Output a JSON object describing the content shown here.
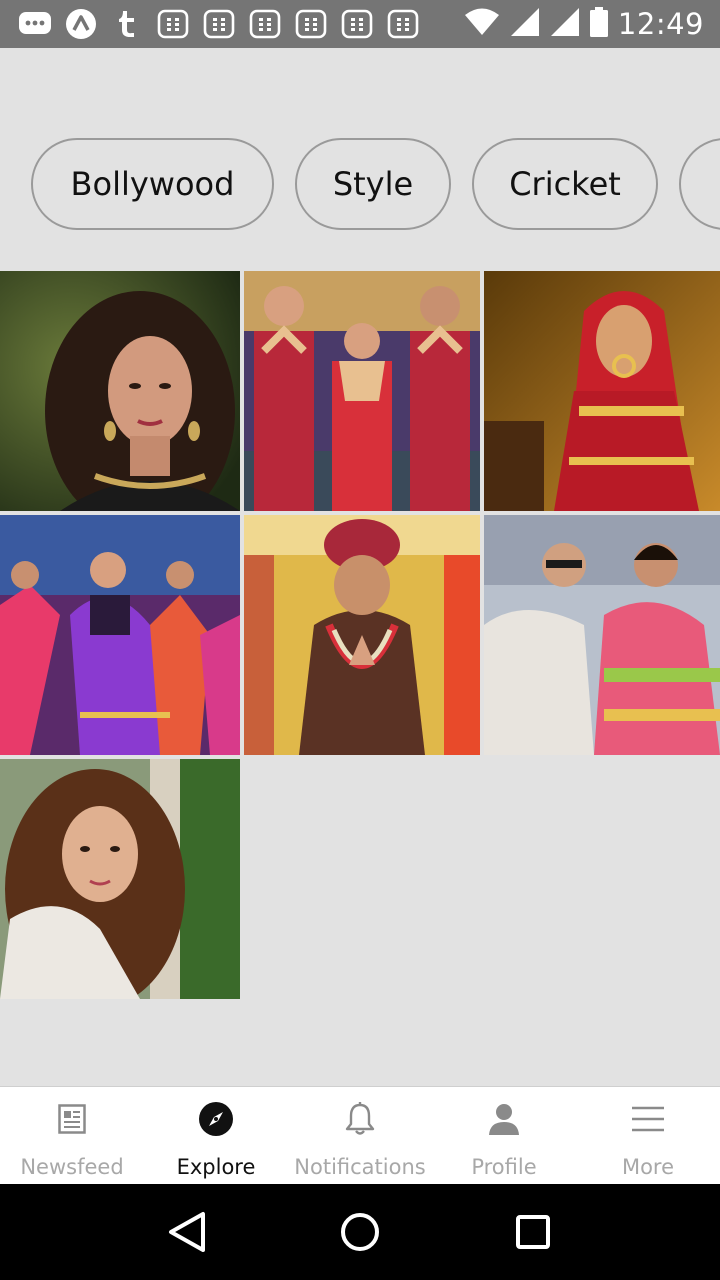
{
  "status_bar": {
    "time": "12:49",
    "icons": [
      "message-icon",
      "app-a-icon",
      "tumblr-icon",
      "calendar-icon",
      "calendar-icon",
      "calendar-icon",
      "calendar-icon",
      "calendar-icon",
      "calendar-icon",
      "wifi-icon",
      "signal-icon",
      "signal-icon",
      "battery-icon"
    ]
  },
  "categories": [
    "Bollywood",
    "Style",
    "Cricket"
  ],
  "grid": {
    "tiles": [
      {
        "name": "woman-portrait-curly-hair",
        "bg": "#3a4a2a",
        "accent": "#c98a6a"
      },
      {
        "name": "dance-trio-red-outfits",
        "bg": "#8a2a3a",
        "accent": "#d43a4a"
      },
      {
        "name": "bride-red-gold-lehenga",
        "bg": "#b8741a",
        "accent": "#c8202a"
      },
      {
        "name": "group-dance-colorful",
        "bg": "#7a2a7a",
        "accent": "#d83a6a"
      },
      {
        "name": "groom-turban-sherwani",
        "bg": "#d9a83a",
        "accent": "#6a3a2a"
      },
      {
        "name": "couple-celebration",
        "bg": "#a8b0c0",
        "accent": "#e85a7a"
      },
      {
        "name": "woman-portrait-sweater",
        "bg": "#6a7a5a",
        "accent": "#7a4a2a"
      }
    ]
  },
  "bottom_nav": {
    "items": [
      {
        "label": "Newsfeed",
        "icon": "newspaper-icon",
        "active": false
      },
      {
        "label": "Explore",
        "icon": "compass-icon",
        "active": true
      },
      {
        "label": "Notifications",
        "icon": "bell-icon",
        "active": false
      },
      {
        "label": "Profile",
        "icon": "person-icon",
        "active": false
      },
      {
        "label": "More",
        "icon": "menu-icon",
        "active": false
      }
    ]
  },
  "colors": {
    "background": "#e2e2e2",
    "status_bar": "#757575",
    "active_label": "#111111",
    "inactive_label": "#a8a8a8"
  }
}
